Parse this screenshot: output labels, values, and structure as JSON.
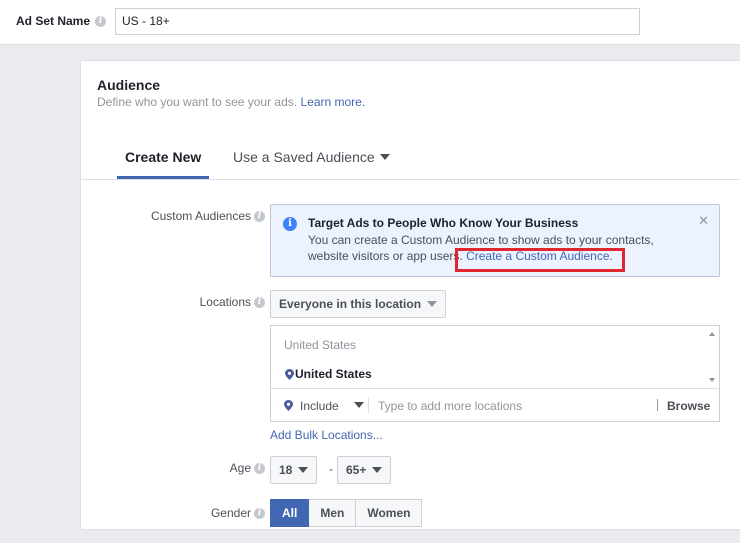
{
  "adset": {
    "label": "Ad Set Name",
    "value": "US - 18+"
  },
  "audience": {
    "title": "Audience",
    "subtitle": "Define who you want to see your ads.",
    "learn_more": "Learn more.",
    "tabs": [
      {
        "label": "Create New",
        "active": true
      },
      {
        "label": "Use a Saved Audience",
        "active": false
      }
    ]
  },
  "custom_audiences": {
    "label": "Custom Audiences",
    "notice_title": "Target Ads to People Who Know Your Business",
    "notice_text": "You can create a Custom Audience to show ads to your contacts, website visitors or app users.",
    "notice_link": "Create a Custom Audience."
  },
  "locations": {
    "label": "Locations",
    "dropdown": "Everyone in this location",
    "country": "United States",
    "selected": "United States",
    "include": "Include",
    "placeholder": "Type to add more locations",
    "browse": "Browse",
    "bulk_link": "Add Bulk Locations..."
  },
  "age": {
    "label": "Age",
    "min": "18",
    "max": "65+",
    "dash": "-"
  },
  "gender": {
    "label": "Gender",
    "options": [
      "All",
      "Men",
      "Women"
    ],
    "selected": "All"
  },
  "colors": {
    "accent": "#4267b2",
    "highlight": "#e0262e",
    "notice_bg": "#ecf3ff"
  }
}
